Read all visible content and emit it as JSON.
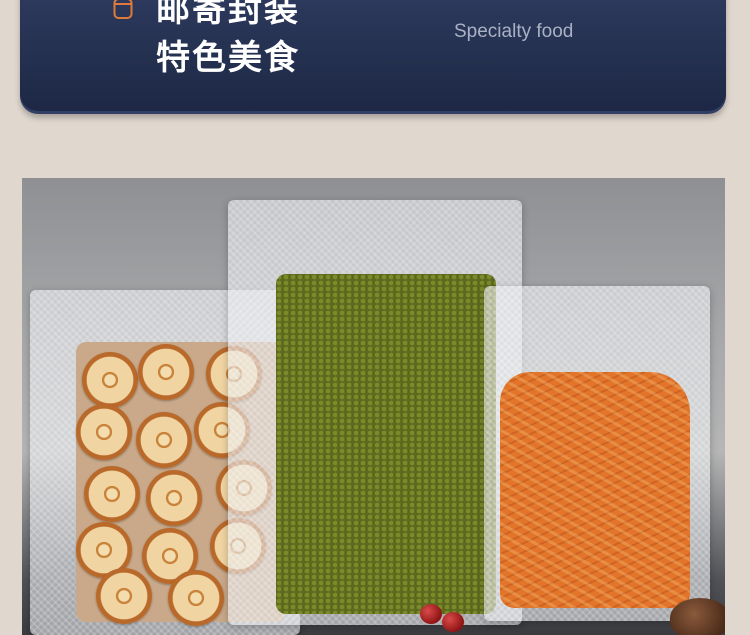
{
  "banner": {
    "title_line1": "邮寄封装",
    "title_line2": "特色美食",
    "subtitle": "Specialty food",
    "icon": "cylinder-icon",
    "accent_color": "#e07a3a",
    "background_color": "#25304f"
  },
  "photo": {
    "products": [
      "dried-lemon-slices-bag",
      "mung-beans-bag",
      "chili-powder-bag"
    ]
  }
}
